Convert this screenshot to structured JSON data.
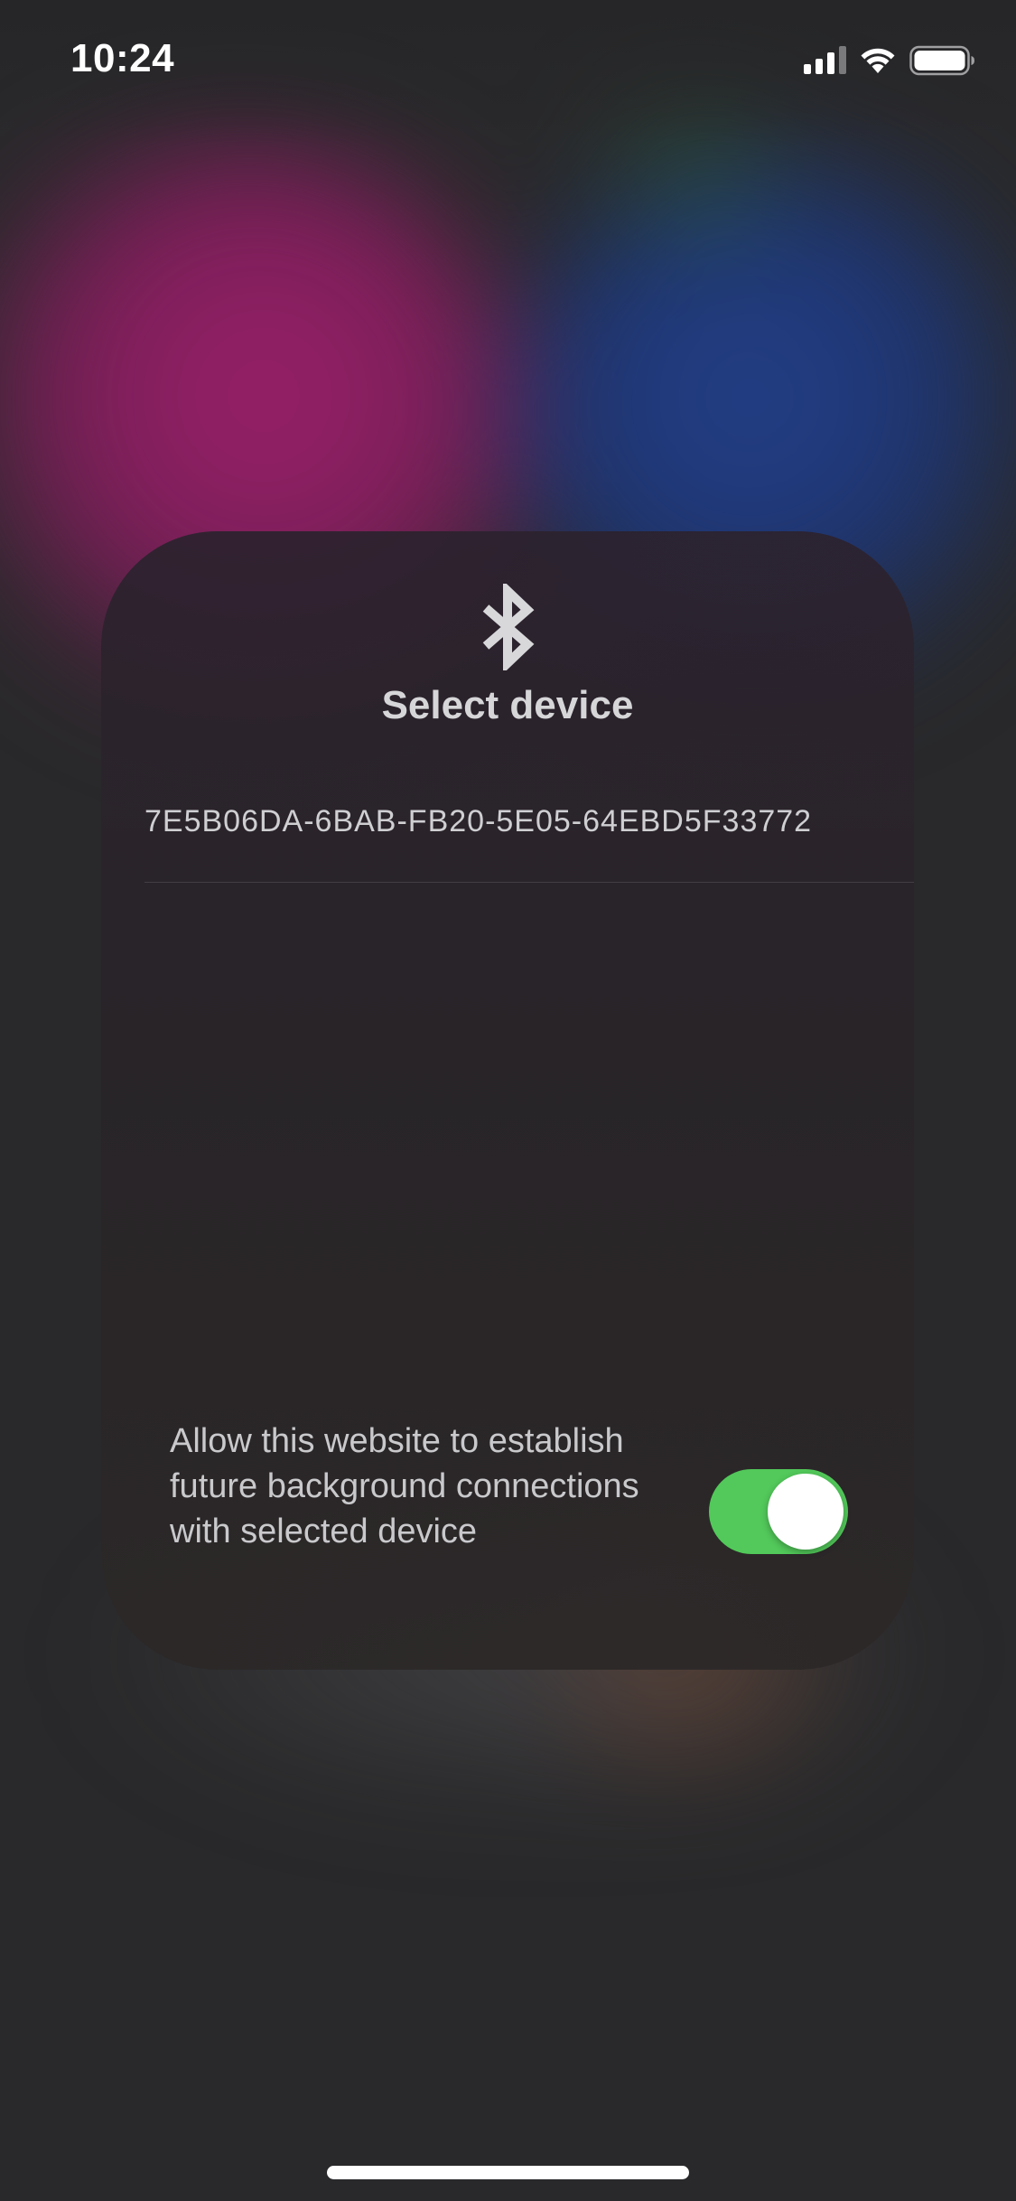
{
  "status_bar": {
    "time": "10:24",
    "icons": [
      "cellular-signal-icon",
      "wifi-icon",
      "battery-icon"
    ]
  },
  "dialog": {
    "icon": "bluetooth-icon",
    "title": "Select device",
    "devices": [
      {
        "id": "7E5B06DA-6BAB-FB20-5E05-64EBD5F33772"
      }
    ],
    "background_permission": {
      "label": "Allow this website to establish future background connections with selected device",
      "enabled": true
    }
  },
  "colors": {
    "toggle_on": "#52c95a",
    "sheet_bg": "#2c262c"
  }
}
